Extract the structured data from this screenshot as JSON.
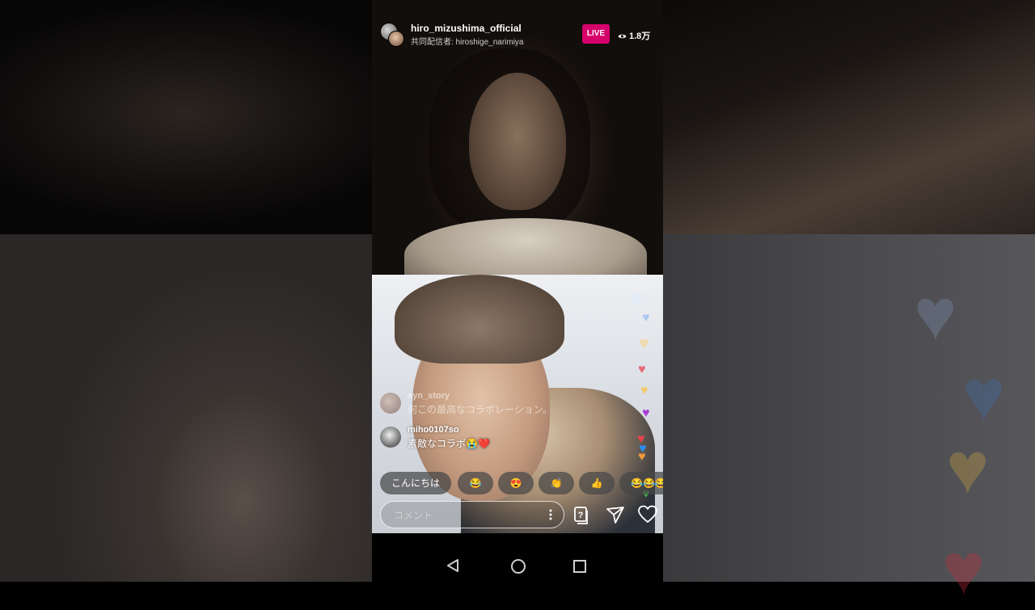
{
  "header": {
    "host_username": "hiro_mizushima_official",
    "cohost_line": "共同配信者: hiroshige_narimiya",
    "live_label": "LIVE",
    "viewer_count": "1.8万",
    "live_color": "#d6006b"
  },
  "comments": [
    {
      "username": "ayn_story",
      "text": "何この最高なコラボレーション。"
    },
    {
      "username": "miho0107so",
      "text": "素敵なコラボ😭❤️"
    }
  ],
  "quick_reactions": [
    "こんにちは",
    "😂",
    "😍",
    "👏",
    "👍",
    "😂😂😂"
  ],
  "comment_input": {
    "placeholder": "コメント"
  },
  "icons": {
    "more": "more-vertical-icon",
    "qa": "question-box-icon",
    "send": "paper-plane-icon",
    "like": "heart-outline-icon",
    "viewers": "eye-icon"
  },
  "floating_heart_colors": [
    "#cfe2f7",
    "#aac9ee",
    "#f2d9a0",
    "#e86a77",
    "#f2c86a",
    "#a63fd1",
    "#e8424f",
    "#2f8df2",
    "#f29a3a",
    "#3ab34a"
  ],
  "nav": {
    "back": "back-triangle-icon",
    "home": "home-circle-icon",
    "recent": "recent-apps-square-icon"
  }
}
